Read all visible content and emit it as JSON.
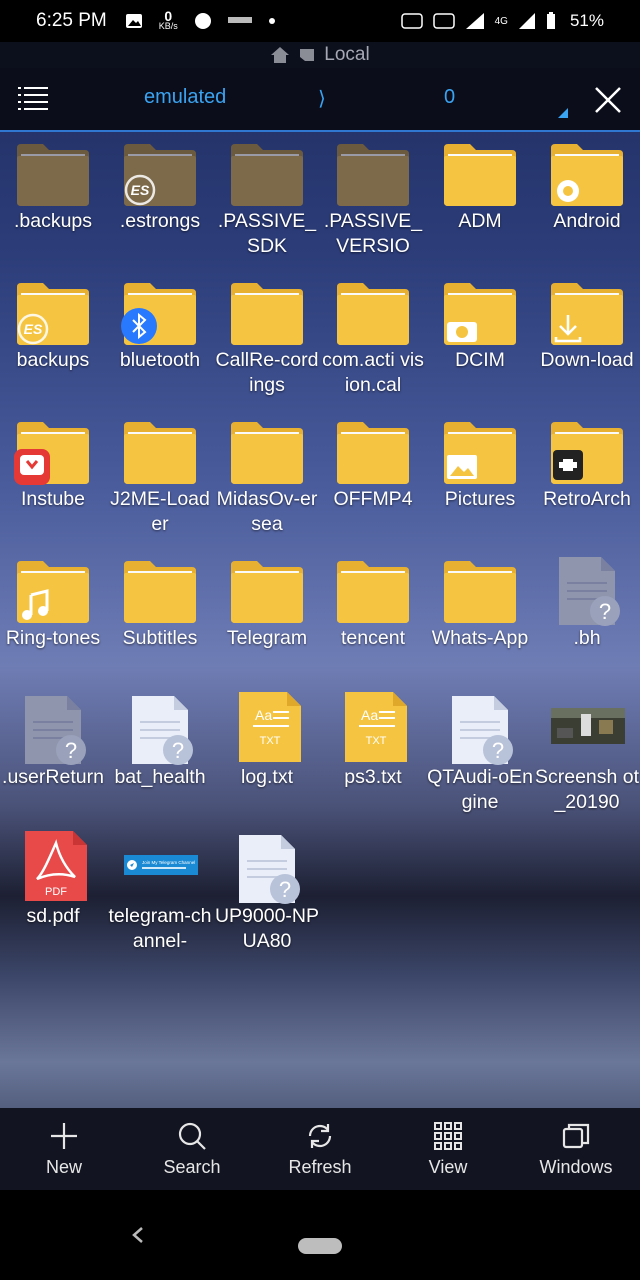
{
  "status": {
    "time": "6:25 PM",
    "speed_value": "0",
    "speed_unit": "KB/s",
    "network": "4G",
    "battery": "51%"
  },
  "breadcrumb": {
    "label": "Local"
  },
  "toolbar": {
    "path": "emulated",
    "separator": "⟩",
    "count": "0"
  },
  "items": [
    {
      "label": ".backups",
      "kind": "folder-dim"
    },
    {
      "label": ".estrongs",
      "kind": "folder-dim",
      "badge": "es"
    },
    {
      "label": ".PASSIVE_SDK",
      "kind": "folder-dim"
    },
    {
      "label": ".PASSIVE_VERSIO",
      "kind": "folder-dim"
    },
    {
      "label": "ADM",
      "kind": "folder"
    },
    {
      "label": "Android",
      "kind": "folder",
      "badge": "gear"
    },
    {
      "label": "backups",
      "kind": "folder",
      "badge": "es"
    },
    {
      "label": "bluetooth",
      "kind": "folder",
      "badge": "bluetooth"
    },
    {
      "label": "CallRe-cordings",
      "kind": "folder"
    },
    {
      "label": "com.acti vision.cal",
      "kind": "folder"
    },
    {
      "label": "DCIM",
      "kind": "folder",
      "badge": "camera"
    },
    {
      "label": "Down-load",
      "kind": "folder",
      "badge": "download"
    },
    {
      "label": "Instube",
      "kind": "folder",
      "badge": "instube"
    },
    {
      "label": "J2ME-Loader",
      "kind": "folder"
    },
    {
      "label": "MidasOv-ersea",
      "kind": "folder"
    },
    {
      "label": "OFFMP4",
      "kind": "folder"
    },
    {
      "label": "Pictures",
      "kind": "folder",
      "badge": "picture"
    },
    {
      "label": "RetroArch",
      "kind": "folder",
      "badge": "retro"
    },
    {
      "label": "Ring-tones",
      "kind": "folder",
      "badge": "music"
    },
    {
      "label": "Subtitles",
      "kind": "folder"
    },
    {
      "label": "Telegram",
      "kind": "folder"
    },
    {
      "label": "tencent",
      "kind": "folder"
    },
    {
      "label": "Whats-App",
      "kind": "folder"
    },
    {
      "label": ".bh",
      "kind": "file-unknown-dim"
    },
    {
      "label": ".userReturn",
      "kind": "file-unknown-dim"
    },
    {
      "label": "bat_health",
      "kind": "file-unknown"
    },
    {
      "label": "log.txt",
      "kind": "txt",
      "badge_text": "TXT"
    },
    {
      "label": "ps3.txt",
      "kind": "txt",
      "badge_text": "TXT"
    },
    {
      "label": "QTAudi-oEngine",
      "kind": "file-unknown"
    },
    {
      "label": "Screensh ot_20190",
      "kind": "image"
    },
    {
      "label": "sd.pdf",
      "kind": "pdf",
      "badge_text": "PDF"
    },
    {
      "label": "telegram-channel-",
      "kind": "image-telegram",
      "thumb_text": "Join My Telegram Channel"
    },
    {
      "label": "UP9000-NPUA80",
      "kind": "file-unknown"
    }
  ],
  "bottom_nav": [
    {
      "label": "New",
      "icon": "plus-icon"
    },
    {
      "label": "Search",
      "icon": "search-icon"
    },
    {
      "label": "Refresh",
      "icon": "refresh-icon"
    },
    {
      "label": "View",
      "icon": "grid-icon"
    },
    {
      "label": "Windows",
      "icon": "windows-icon"
    }
  ],
  "colors": {
    "accent": "#3aa3f2",
    "folder": "#f5c542",
    "folder_tab": "#e9b132"
  }
}
